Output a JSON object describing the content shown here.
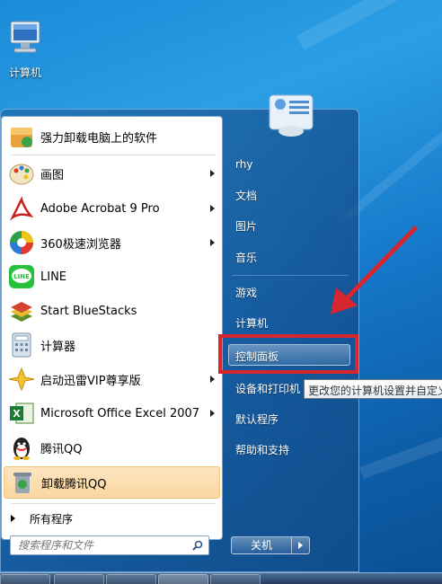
{
  "desktop": {
    "icon_label": "计算机"
  },
  "programs": [
    {
      "label": "强力卸载电脑上的软件",
      "icon": "uninstaller-icon",
      "has_submenu": false
    },
    {
      "label": "画图",
      "icon": "paint-icon",
      "has_submenu": true
    },
    {
      "label": "Adobe Acrobat 9 Pro",
      "icon": "acrobat-icon",
      "has_submenu": true
    },
    {
      "label": "360极速浏览器",
      "icon": "360-browser-icon",
      "has_submenu": true
    },
    {
      "label": "LINE",
      "icon": "line-icon",
      "has_submenu": false
    },
    {
      "label": "Start BlueStacks",
      "icon": "bluestacks-icon",
      "has_submenu": false
    },
    {
      "label": "计算器",
      "icon": "calculator-icon",
      "has_submenu": false
    },
    {
      "label": "启动迅雷VIP尊享版",
      "icon": "thunder-icon",
      "has_submenu": true
    },
    {
      "label": "Microsoft Office Excel 2007",
      "icon": "excel-icon",
      "has_submenu": true
    },
    {
      "label": "腾讯QQ",
      "icon": "qq-icon",
      "has_submenu": false
    },
    {
      "label": "卸载腾讯QQ",
      "icon": "uninstall-qq-icon",
      "has_submenu": false
    }
  ],
  "all_programs_label": "所有程序",
  "search": {
    "placeholder": "搜索程序和文件"
  },
  "right_pane": {
    "user": "rhy",
    "documents": "文档",
    "pictures": "图片",
    "music": "音乐",
    "games": "游戏",
    "computer": "计算机",
    "control_panel": "控制面板",
    "devices_printers": "设备和打印机",
    "default_programs": "默认程序",
    "help_support": "帮助和支持"
  },
  "tooltip": "更改您的计算机设置并自定义",
  "shutdown_label": "关机",
  "colors": {
    "highlight_border": "#d8262e",
    "hover_item": "#fbd7a0",
    "arrow": "#d8262e"
  }
}
